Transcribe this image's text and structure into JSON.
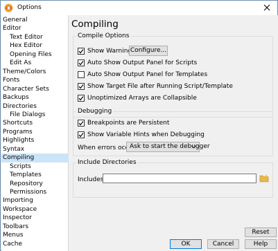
{
  "window": {
    "title": "Options",
    "close_glyph": "✕"
  },
  "sidebar": {
    "items": [
      {
        "label": "General",
        "level": 1
      },
      {
        "label": "Editor",
        "level": 1
      },
      {
        "label": "Text Editor",
        "level": 2
      },
      {
        "label": "Hex Editor",
        "level": 2
      },
      {
        "label": "Opening Files",
        "level": 2
      },
      {
        "label": "Edit As",
        "level": 2
      },
      {
        "label": "Theme/Colors",
        "level": 1
      },
      {
        "label": "Fonts",
        "level": 1
      },
      {
        "label": "Character Sets",
        "level": 1
      },
      {
        "label": "Backups",
        "level": 1
      },
      {
        "label": "Directories",
        "level": 1
      },
      {
        "label": "File Dialogs",
        "level": 2
      },
      {
        "label": "Shortcuts",
        "level": 1
      },
      {
        "label": "Programs",
        "level": 1
      },
      {
        "label": "Highlights",
        "level": 1
      },
      {
        "label": "Syntax",
        "level": 1
      },
      {
        "label": "Compiling",
        "level": 1,
        "selected": true
      },
      {
        "label": "Scripts",
        "level": 2
      },
      {
        "label": "Templates",
        "level": 2
      },
      {
        "label": "Repository",
        "level": 2
      },
      {
        "label": "Permissions",
        "level": 2
      },
      {
        "label": "Importing",
        "level": 1
      },
      {
        "label": "Workspace",
        "level": 1
      },
      {
        "label": "Inspector",
        "level": 1
      },
      {
        "label": "Toolbars",
        "level": 1
      },
      {
        "label": "Menus",
        "level": 1
      },
      {
        "label": "Cache",
        "level": 1
      }
    ]
  },
  "page": {
    "title": "Compiling"
  },
  "compile_options": {
    "title": "Compile Options",
    "show_warnings": {
      "label": "Show Warnings",
      "checked": true
    },
    "configure_button": "Configure...",
    "auto_show_scripts": {
      "label": "Auto Show Output Panel for Scripts",
      "checked": true
    },
    "auto_show_templates": {
      "label": "Auto Show Output Panel for Templates",
      "checked": false
    },
    "show_target_file": {
      "label": "Show Target File after Running Script/Template",
      "checked": true
    },
    "unoptimized_arrays": {
      "label": "Unoptimized Arrays are Collapsible",
      "checked": true
    }
  },
  "debugging": {
    "title": "Debugging",
    "breakpoints_persistent": {
      "label": "Breakpoints are Persistent",
      "checked": true
    },
    "show_variable_hints": {
      "label": "Show Variable Hints when Debugging",
      "checked": true
    },
    "when_errors_label": "When errors occur:",
    "when_errors_value": "Ask to start the debugger"
  },
  "include_dirs": {
    "title": "Include Directories",
    "includes_label": "Includes:",
    "includes_value": ""
  },
  "buttons": {
    "reset": "Reset",
    "ok": "OK",
    "cancel": "Cancel",
    "help": "Help"
  },
  "colors": {
    "selection": "#cce4f7",
    "accent": "#0078d7",
    "folder": "#e8b84a"
  }
}
